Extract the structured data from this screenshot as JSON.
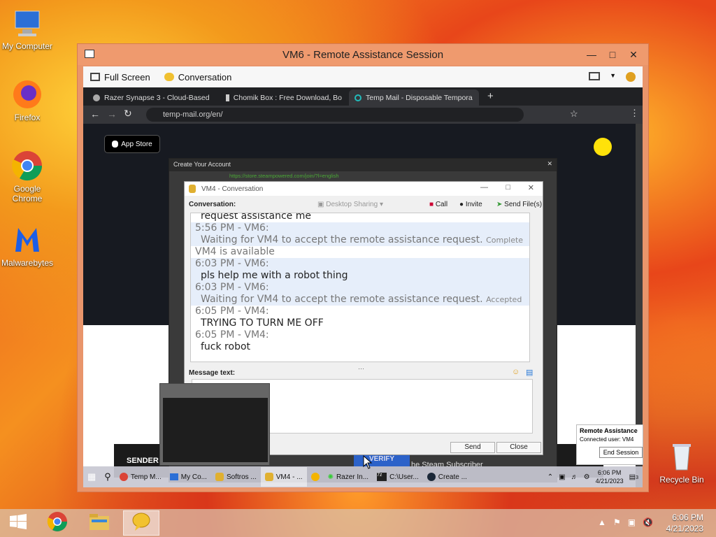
{
  "desktop": {
    "icons": [
      {
        "label": "My Computer"
      },
      {
        "label": "Firefox"
      },
      {
        "label": "Google Chrome"
      },
      {
        "label": "Malwarebytes"
      },
      {
        "label": "Recycle Bin"
      }
    ]
  },
  "ra_window": {
    "title": "VM6 - Remote Assistance Session",
    "toolbar": {
      "full_screen": "Full Screen",
      "conversation": "Conversation"
    }
  },
  "chrome": {
    "tabs": [
      {
        "label": "Razer Synapse 3 - Cloud-Based"
      },
      {
        "label": "Chomik Box : Free Download, Bo"
      },
      {
        "label": "Temp Mail - Disposable Tempora"
      }
    ],
    "url": "temp-mail.org/en/",
    "app_store": "App Store",
    "sender": "SENDER",
    "verify": "VERIFY",
    "subscriber": "he Steam Subscriber"
  },
  "steam_window": {
    "title": "Create Your Account",
    "url": "https://store.steampowered.com/join/?l=english"
  },
  "conversation": {
    "title": "VM4 - Conversation",
    "label": "Conversation:",
    "tools": {
      "desktop_sharing": "Desktop Sharing",
      "call": "Call",
      "invite": "Invite",
      "send_files": "Send File(s)"
    },
    "lines": [
      {
        "text": "request assistance me",
        "style": "indent"
      },
      {
        "text": "5:56 PM - VM6:",
        "style": "hl grey"
      },
      {
        "text": "Waiting for VM4 to accept the remote assistance request.",
        "suffix": "Complete",
        "style": "hl indent grey"
      },
      {
        "text": "VM4 is available",
        "style": "grey"
      },
      {
        "text": "6:03 PM - VM6:",
        "style": "hl grey"
      },
      {
        "text": "pls help me with a robot thing",
        "style": "hl indent"
      },
      {
        "text": "6:03 PM - VM6:",
        "style": "hl grey"
      },
      {
        "text": "Waiting for VM4 to accept the remote assistance request.",
        "suffix": "Accepted",
        "style": "hl indent grey"
      },
      {
        "text": "6:05 PM - VM4:",
        "style": "grey"
      },
      {
        "text": "TRYING TO TURN ME OFF",
        "style": "indent"
      },
      {
        "text": "6:05 PM - VM4:",
        "style": "grey"
      },
      {
        "text": "fuck robot",
        "style": "indent"
      }
    ],
    "message_label": "Message text:",
    "send": "Send",
    "close": "Close"
  },
  "ra_popup": {
    "title": "Remote Assistance",
    "status": "Connected user: VM4",
    "end_session": "End Session"
  },
  "remote_taskbar": {
    "items": [
      {
        "label": "Temp M..."
      },
      {
        "label": "My Co..."
      },
      {
        "label": "Softros ..."
      },
      {
        "label": "VM4 - ..."
      },
      {
        "label": "Razer In..."
      },
      {
        "label": "C:\\User..."
      },
      {
        "label": "Create ..."
      }
    ],
    "time": "6:06 PM",
    "date": "4/21/2023",
    "notif_count": "3"
  },
  "host_clock": {
    "time": "6:06 PM",
    "date": "4/21/2023"
  }
}
